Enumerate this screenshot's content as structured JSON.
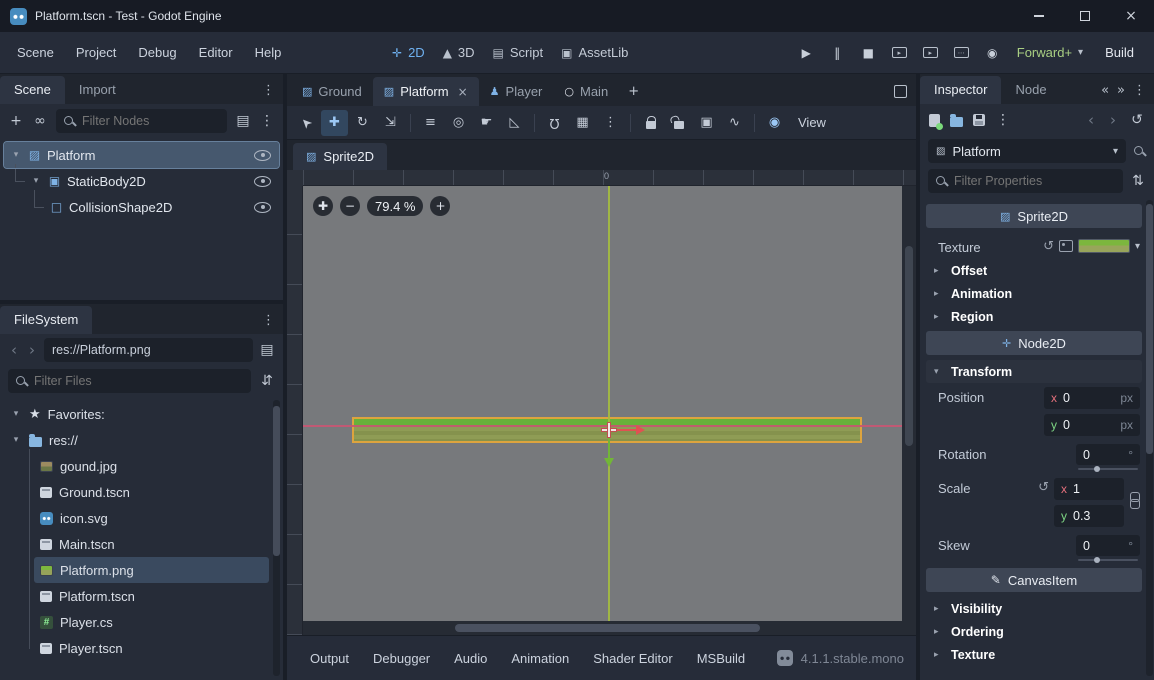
{
  "window": {
    "title": "Platform.tscn - Test - Godot Engine"
  },
  "menubar": {
    "items": [
      "Scene",
      "Project",
      "Debug",
      "Editor",
      "Help"
    ]
  },
  "mode_switcher": {
    "items": [
      "2D",
      "3D",
      "Script",
      "AssetLib"
    ],
    "active": "2D"
  },
  "run_bar": {
    "renderer": "Forward+",
    "build": "Build"
  },
  "scene_dock": {
    "tabs": [
      "Scene",
      "Import"
    ],
    "filter_placeholder": "Filter Nodes",
    "nodes": [
      {
        "name": "Platform"
      },
      {
        "name": "StaticBody2D"
      },
      {
        "name": "CollisionShape2D"
      }
    ]
  },
  "filesystem": {
    "title": "FileSystem",
    "path": "res://Platform.png",
    "filter_placeholder": "Filter Files",
    "favorites": "Favorites:",
    "root": "res://",
    "files": [
      "gound.jpg",
      "Ground.tscn",
      "icon.svg",
      "Main.tscn",
      "Platform.png",
      "Platform.tscn",
      "Player.cs",
      "Player.tscn"
    ]
  },
  "scene_tabs": [
    "Ground",
    "Platform",
    "Player",
    "Main"
  ],
  "canvas_toolbar": {
    "view": "View"
  },
  "edited_node": "Sprite2D",
  "viewport": {
    "zoom": "79.4 %",
    "ruler_origin": "0"
  },
  "bottom_panel": {
    "items": [
      "Output",
      "Debugger",
      "Audio",
      "Animation",
      "Shader Editor",
      "MSBuild"
    ],
    "version": "4.1.1.stable.mono"
  },
  "inspector": {
    "tabs": [
      "Inspector",
      "Node"
    ],
    "object": "Platform",
    "filter_placeholder": "Filter Properties",
    "sprite2d": {
      "header": "Sprite2D",
      "texture_label": "Texture",
      "groups": [
        "Offset",
        "Animation",
        "Region"
      ]
    },
    "node2d": {
      "header": "Node2D",
      "transform_label": "Transform",
      "position": {
        "label": "Position",
        "x": "0",
        "y": "0",
        "unit": "px"
      },
      "rotation": {
        "label": "Rotation",
        "value": "0",
        "unit": "°"
      },
      "scale": {
        "label": "Scale",
        "x": "1",
        "y": "0.3"
      },
      "skew": {
        "label": "Skew",
        "value": "0",
        "unit": "°"
      }
    },
    "canvasitem": {
      "header": "CanvasItem",
      "groups": [
        "Visibility",
        "Ordering",
        "Texture"
      ]
    },
    "axis": {
      "x": "x",
      "y": "y"
    }
  },
  "colors": {
    "accent_blue": "#6fb1f0",
    "renderer_green": "#a9cf83",
    "axis_x_red": "#e5707c",
    "axis_y_green": "#7ed584",
    "selection_border_orange": "#dda43e",
    "godot_blue": "#478cbf"
  },
  "icons": {
    "close": "×",
    "menu_dots": "⋮",
    "dots": "⋯",
    "caret_down": "▾",
    "caret_right": "▸",
    "chevron_left": "‹",
    "chevron_right": "›",
    "chevrons_left": "«",
    "chevrons_right": "»",
    "plus": "+",
    "minus": "−",
    "star": "★",
    "instance_link": "∞",
    "play": "▶",
    "pause": "‖",
    "stop": "■",
    "reel": "◉",
    "select": "➤",
    "move": "✚",
    "rotate": "↻",
    "scale": "⇲",
    "list_select": "≡",
    "pivot": "◎",
    "pan": "☛",
    "ruler": "◺",
    "magnet": "Ω",
    "grid": "▦",
    "group": "▣",
    "skeleton": "∿",
    "pin": "◉",
    "sprite_node": "▨",
    "body_node": "▣",
    "shape_node": "□",
    "player_node": "♟",
    "node": "○",
    "mode_2d": "✛",
    "mode_3d": "▲",
    "mode_script": "▤",
    "mode_assetlib": "▣",
    "split_view": "▤",
    "sort": "⇵",
    "tune": "⇅",
    "revert": "↺",
    "pencil": "✎",
    "node2d": "✛",
    "hash": "#",
    "script_page": "▤"
  }
}
